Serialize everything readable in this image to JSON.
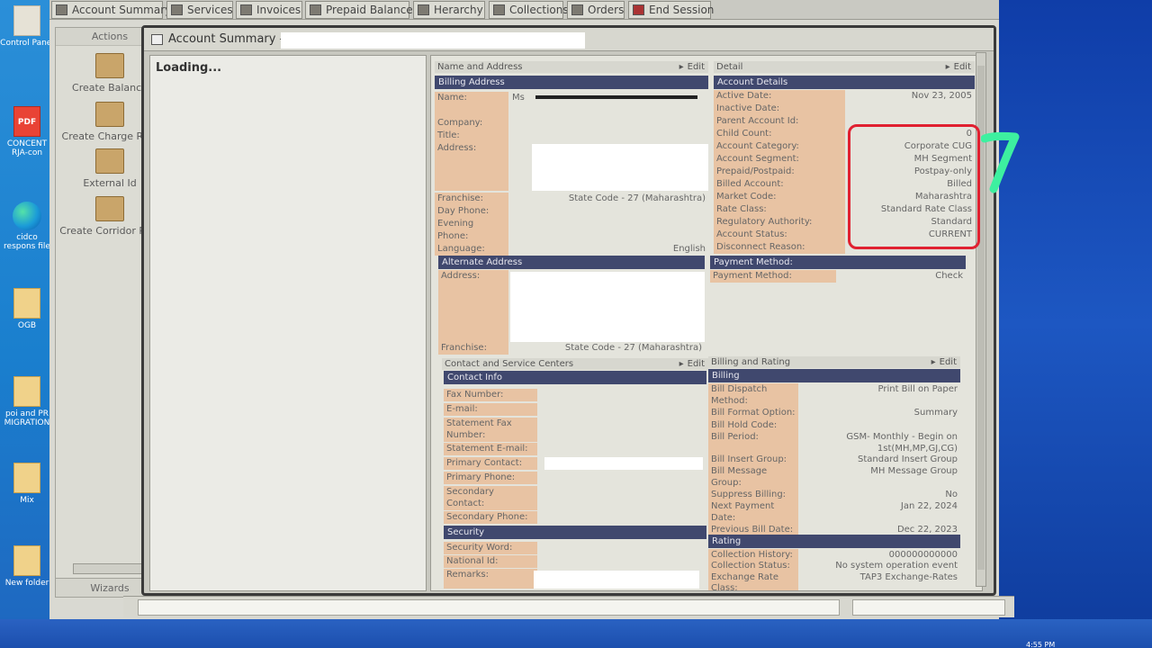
{
  "menu": [
    {
      "label": "Account Summary",
      "icon": "account-summary-icon"
    },
    {
      "label": "Services",
      "icon": "services-icon"
    },
    {
      "label": "Invoices",
      "icon": "invoices-icon"
    },
    {
      "label": "Prepaid Balances",
      "icon": "prepaid-balances-icon"
    },
    {
      "label": "Herarchy",
      "icon": "hierarchy-icon"
    },
    {
      "label": "Collections",
      "icon": "collections-icon"
    },
    {
      "label": "Orders",
      "icon": "orders-icon"
    },
    {
      "label": "End Session",
      "icon": "end-session-icon"
    }
  ],
  "actions": {
    "title": "Actions",
    "items": [
      "Create Balance",
      "Create Charge Rule",
      "External Id",
      "Create Corridor Plan"
    ],
    "footer": "Wizards"
  },
  "window_title": "Account Summary -",
  "loading": "Loading...",
  "name_address": {
    "header": "Name and Address",
    "edit": "Edit",
    "billing_band": "Billing Address",
    "name_label": "Name:",
    "name_prefix": "Ms",
    "company_label": "Company:",
    "title_label": "Title:",
    "address_label": "Address:",
    "franchise_label": "Franchise:",
    "franchise_value": "State Code - 27 (Maharashtra)",
    "day_phone_label": "Day Phone:",
    "evening_label": "Evening",
    "phone_label": "Phone:",
    "language_label": "Language:",
    "language_value": "English",
    "alt_band": "Alternate Address",
    "alt_address_label": "Address:",
    "alt_franchise_label": "Franchise:",
    "alt_franchise_value": "State Code - 27 (Maharashtra)"
  },
  "detail": {
    "header": "Detail",
    "edit": "Edit",
    "band": "Account Details",
    "rows": [
      {
        "label": "Active Date:",
        "value": "Nov 23, 2005"
      },
      {
        "label": "Inactive Date:",
        "value": ""
      },
      {
        "label": "Parent Account Id:",
        "value": ""
      },
      {
        "label": "Child Count:",
        "value": "0"
      },
      {
        "label": "Account Category:",
        "value": "Corporate CUG"
      },
      {
        "label": "Account Segment:",
        "value": "MH Segment"
      },
      {
        "label": "Prepaid/Postpaid:",
        "value": "Postpay-only"
      },
      {
        "label": "Billed Account:",
        "value": "Billed"
      },
      {
        "label": "Market Code:",
        "value": "Maharashtra"
      },
      {
        "label": "Rate Class:",
        "value": "Standard Rate Class"
      },
      {
        "label": "Regulatory Authority:",
        "value": "Standard"
      },
      {
        "label": "Account Status:",
        "value": "CURRENT"
      },
      {
        "label": "Disconnect Reason:",
        "value": ""
      }
    ],
    "payment_band": "Payment Method:",
    "payment_label": "Payment Method:",
    "payment_value": "Check"
  },
  "contact": {
    "header": "Contact and Service Centers",
    "edit": "Edit",
    "band": "Contact Info",
    "rows": [
      "Fax Number:",
      "E-mail:",
      "Statement Fax",
      "Number:",
      "Statement E-mail:",
      "Primary Contact:",
      "Primary Phone:",
      "Secondary",
      "Contact:",
      "Secondary Phone:"
    ],
    "security_band": "Security",
    "security_rows": [
      "Security Word:",
      "National Id:",
      "Remarks:"
    ]
  },
  "billing": {
    "header": "Billing and Rating",
    "edit": "Edit",
    "band": "Billing",
    "rows": [
      {
        "label": "Bill Dispatch",
        "value": "Print Bill on Paper"
      },
      {
        "label": "Method:",
        "value": ""
      },
      {
        "label": "Bill Format Option:",
        "value": "Summary"
      },
      {
        "label": "Bill Hold Code:",
        "value": ""
      },
      {
        "label": "Bill Period:",
        "value": "GSM- Monthly - Begin on"
      },
      {
        "label": "",
        "value": "1st(MH,MP,GJ,CG)"
      },
      {
        "label": "Bill Insert Group:",
        "value": "Standard Insert Group"
      },
      {
        "label": "Bill Message",
        "value": "MH Message Group"
      },
      {
        "label": "Group:",
        "value": ""
      },
      {
        "label": "Suppress Billing:",
        "value": "No"
      },
      {
        "label": "Next Payment",
        "value": "Jan 22, 2024"
      },
      {
        "label": "Date:",
        "value": ""
      },
      {
        "label": "Previous Bill Date:",
        "value": "Dec 22, 2023"
      }
    ],
    "rating_band": "Rating",
    "rating_rows": [
      {
        "label": "Collection History:",
        "value": "000000000000"
      },
      {
        "label": "Collection Status:",
        "value": "No system operation event"
      },
      {
        "label": "Exchange Rate",
        "value": "TAP3 Exchange-Rates"
      },
      {
        "label": "Class:",
        "value": ""
      }
    ]
  },
  "desktop": [
    {
      "label": "Control Panel",
      "type": "app"
    },
    {
      "label": "CONCENT RJA-con",
      "type": "pdf"
    },
    {
      "label": "cidco respons file",
      "type": "edge"
    },
    {
      "label": "OGB",
      "type": "folder"
    },
    {
      "label": "poi and PR MIGRATION",
      "type": "folder"
    },
    {
      "label": "Mix",
      "type": "folder"
    },
    {
      "label": "New folder",
      "type": "folder"
    }
  ],
  "clock": "4:55 PM"
}
